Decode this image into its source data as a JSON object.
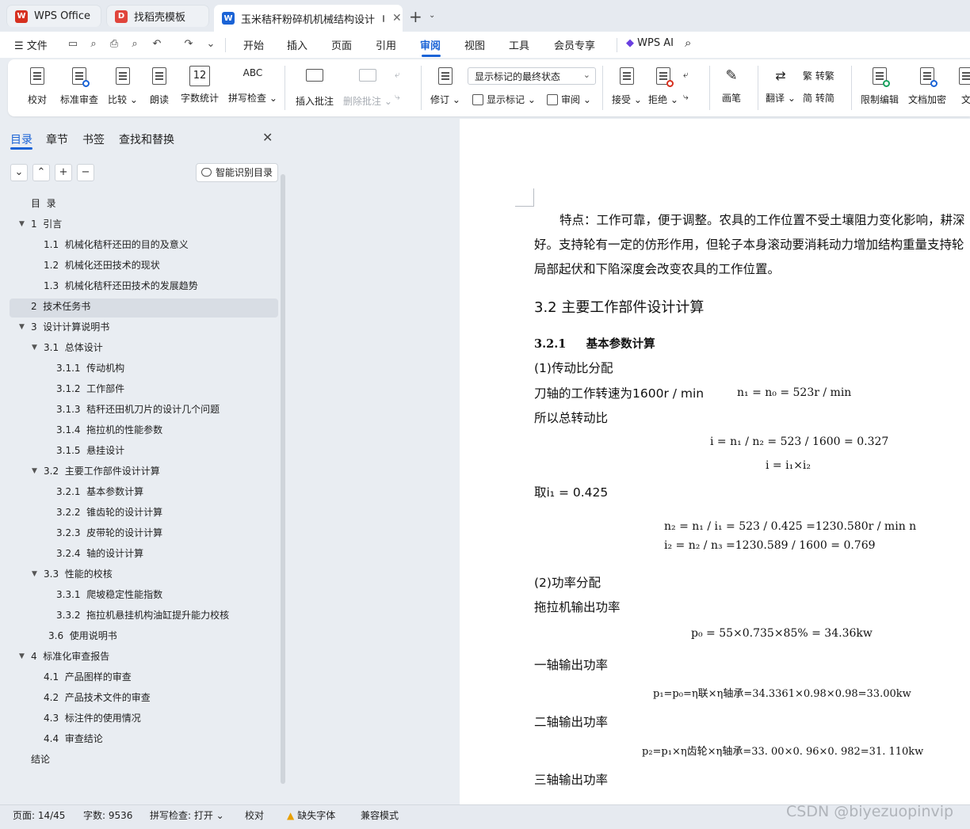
{
  "tabs": [
    {
      "label": "WPS Office",
      "logo": "W"
    },
    {
      "label": "找稻壳模板",
      "logo": "D"
    },
    {
      "label": "玉米秸秆粉碎机机械结构设计",
      "logo": "W"
    }
  ],
  "colors": {
    "accent": "#1a63d6",
    "wps_red": "#d6301f",
    "docer_red": "#e0443b"
  },
  "menu": {
    "file": "文件",
    "items": [
      "开始",
      "插入",
      "页面",
      "引用",
      "审阅",
      "视图",
      "工具",
      "会员专享"
    ],
    "selected": "审阅",
    "wps_ai": "WPS AI"
  },
  "ribbon": {
    "proofread": "校对",
    "std_review": "标准审查",
    "compare": "比较",
    "read_aloud": "朗读",
    "word_count": "字数统计",
    "spell_check": "拼写检查",
    "insert_comment": "插入批注",
    "delete_comment": "删除批注",
    "track_changes": "修订",
    "display_state": "显示标记的最终状态",
    "show_markup": "显示标记",
    "review": "审阅",
    "accept": "接受",
    "reject": "拒绝",
    "pen": "画笔",
    "translate": "翻译",
    "to_traditional": "转繁",
    "to_simplified": "转简",
    "restrict_edit": "限制编辑",
    "doc_encrypt": "文档加密",
    "doc_cut": "文"
  },
  "nav": {
    "tabs": [
      "目录",
      "章节",
      "书签",
      "查找和替换"
    ],
    "smart_toc": "智能识别目录",
    "toc": [
      {
        "text": "目  录",
        "level": 0,
        "arrow": false
      },
      {
        "text": "1  引言",
        "level": 0,
        "arrow": true
      },
      {
        "text": "1.1  机械化秸秆还田的目的及意义",
        "level": 1,
        "arrow": false
      },
      {
        "text": "1.2  机械化还田技术的现状",
        "level": 1,
        "arrow": false
      },
      {
        "text": "1.3  机械化秸秆还田技术的发展趋势",
        "level": 1,
        "arrow": false
      },
      {
        "text": "2  技术任务书",
        "level": 0,
        "arrow": false
      },
      {
        "text": "3  设计计算说明书",
        "level": 0,
        "arrow": true
      },
      {
        "text": "3.1  总体设计",
        "level": 1,
        "arrow": true
      },
      {
        "text": "3.1.1  传动机构",
        "level": 2,
        "arrow": false
      },
      {
        "text": "3.1.2  工作部件",
        "level": 2,
        "arrow": false
      },
      {
        "text": "3.1.3  秸秆还田机刀片的设计几个问题",
        "level": 2,
        "arrow": false
      },
      {
        "text": "3.1.4  拖拉机的性能参数",
        "level": 2,
        "arrow": false
      },
      {
        "text": "3.1.5  悬挂设计",
        "level": 2,
        "arrow": false
      },
      {
        "text": "3.2  主要工作部件设计计算",
        "level": 1,
        "arrow": true
      },
      {
        "text": "3.2.1  基本参数计算",
        "level": 2,
        "arrow": false
      },
      {
        "text": "3.2.2  锥齿轮的设计计算",
        "level": 2,
        "arrow": false
      },
      {
        "text": "3.2.3  皮带轮的设计计算",
        "level": 2,
        "arrow": false
      },
      {
        "text": "3.2.4  轴的设计计算",
        "level": 2,
        "arrow": false
      },
      {
        "text": "3.3  性能的校核",
        "level": 1,
        "arrow": true
      },
      {
        "text": "3.3.1  爬坡稳定性能指数",
        "level": 2,
        "arrow": false
      },
      {
        "text": "3.3.2  拖拉机悬挂机构油缸提升能力校核",
        "level": 2,
        "arrow": false
      },
      {
        "text": "3.6  使用说明书",
        "level": 1.4,
        "arrow": false
      },
      {
        "text": "4  标准化审查报告",
        "level": 0,
        "arrow": true
      },
      {
        "text": "4.1  产品图样的审查",
        "level": 1,
        "arrow": false
      },
      {
        "text": "4.2  产品技术文件的审查",
        "level": 1,
        "arrow": false
      },
      {
        "text": "4.3  标注件的使用情况",
        "level": 1,
        "arrow": false
      },
      {
        "text": "4.4  审查结论",
        "level": 1,
        "arrow": false
      },
      {
        "text": "结论",
        "level": 0,
        "arrow": false
      }
    ],
    "selected_index": 5
  },
  "doc": {
    "para1_line1": "特点：工作可靠，便于调整。农具的工作位置不受土壤阻力变化影响，耕深",
    "para1_line2": "好。支持轮有一定的仿形作用，但轮子本身滚动要消耗动力增加结构重量支持轮",
    "para1_line3": "局部起伏和下陷深度会改变农具的工作位置。",
    "h2": "3.2 主要工作部件设计计算",
    "h3": "3.2.1     基本参数计算",
    "s1": "(1)传动比分配",
    "line_rpm": "刀轴的工作转速为1600r / min",
    "eq_n1": "n₁ = n₀ = 523r / min",
    "total_ratio": "所以总转动比",
    "eq_i": "i = n₁ / n₂ = 523 / 1600 = 0.327",
    "eq_i12": "i = i₁×i₂",
    "take_i1": "取i₁ = 0.425",
    "eq_n2": "n₂ = n₁ / i₁ = 523 / 0.425 =1230.580r / min n",
    "eq_i2": "i₂ = n₂ / n₃ =1230.589 / 1600 = 0.769",
    "s2": "(2)功率分配",
    "tractor_power": "拖拉机输出功率",
    "eq_p0": "p₀ = 55×0.735×85% = 34.36kw",
    "shaft1": "一轴输出功率",
    "eq_p1": "p₁=p₀=η联×η轴承=34.3361×0.98×0.98=33.00kw",
    "shaft2": "二轴输出功率",
    "eq_p2": "p₂=p₁×η齿轮×η轴承=33. 00×0. 96×0. 982=31. 110kw",
    "shaft3": "三轴输出功率"
  },
  "status": {
    "page": "页面: 14/45",
    "words": "字数: 9536",
    "spell": "拼写检查: 打开",
    "proof": "校对",
    "missing_font": "缺失字体",
    "compat": "兼容模式"
  },
  "watermark": "CSDN @biyezuopinvip"
}
